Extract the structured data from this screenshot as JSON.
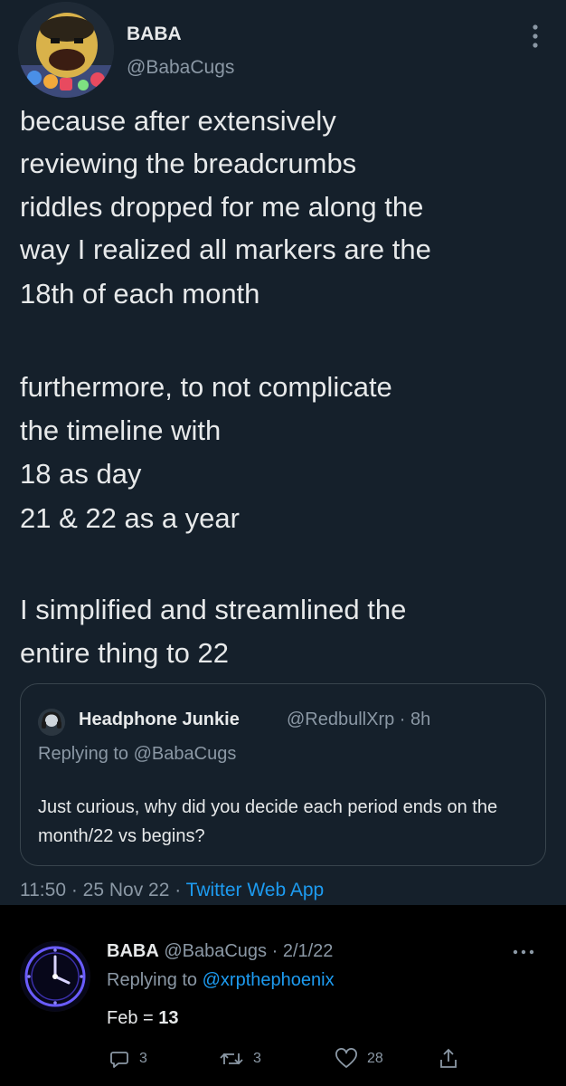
{
  "tweet": {
    "author_name": "BABA",
    "author_handle": "@BabaCugs",
    "lines": [
      "because after extensively",
      "reviewing the breadcrumbs",
      "riddles dropped for me along the",
      "way I realized all markers are the",
      "18th of each month",
      "furthermore, to not complicate",
      "the timeline with",
      "18 as day",
      "21 & 22 as a year",
      "I simplified and streamlined the",
      "entire thing to 22"
    ],
    "quoted": {
      "name": "Headphone Junkie",
      "handle_time": "@RedbullXrp · 8h",
      "replying_label": "Replying to",
      "replying_handle": "@BabaCugs",
      "text": "Just curious, why did you decide each period ends on the month/22 vs begins?"
    },
    "timestamp": "11:50 · 25 Nov 22 · ",
    "source": "Twitter Web App"
  },
  "reply": {
    "name": "BABA",
    "handle_date": "@BabaCugs · 2/1/22",
    "replying_label": "Replying to",
    "replying_handle": "@xrpthephoenix",
    "text_prefix": "Feb = ",
    "text_bold": "13",
    "replies": "3",
    "retweets": "3",
    "likes": "28"
  },
  "colors": {
    "background": "#15202b",
    "reply_background": "#000000",
    "primary_text": "#e7e9ea",
    "secondary_text": "#8b98a5",
    "accent": "#1d9bf0",
    "border": "#38444d"
  },
  "icons": [
    "more-vertical-icon",
    "more-horizontal-icon",
    "reply-icon",
    "retweet-icon",
    "like-icon",
    "share-icon",
    "avatar-image",
    "clock-avatar-image"
  ]
}
